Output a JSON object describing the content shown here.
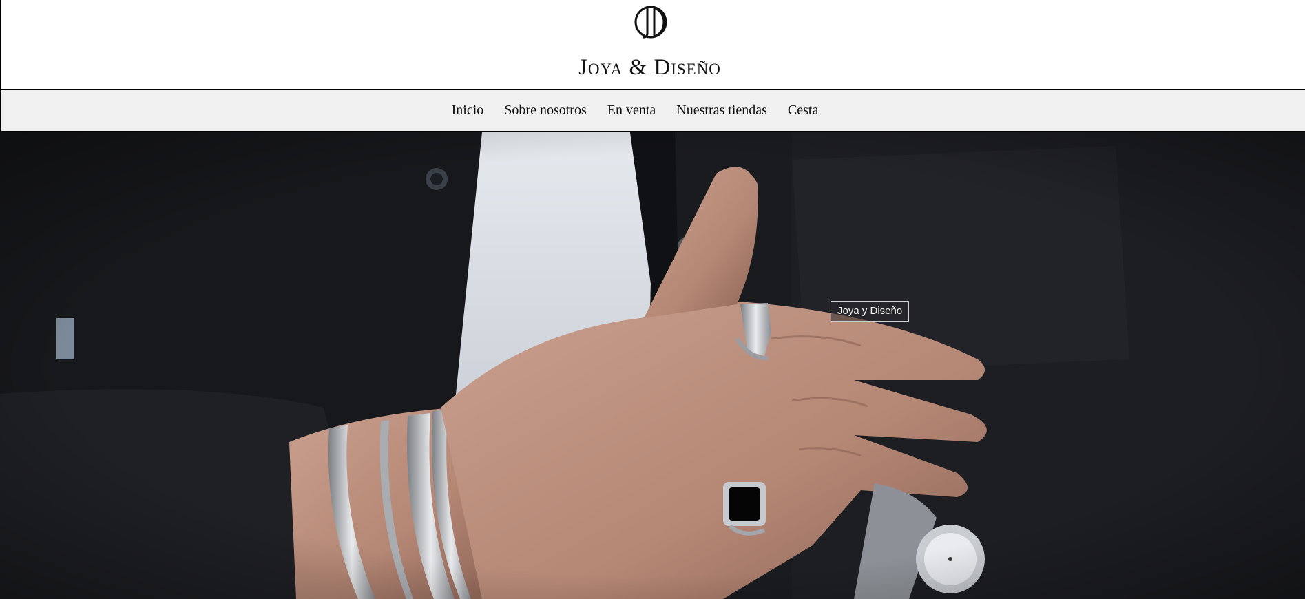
{
  "header": {
    "logo_icon": "jd-monogram-icon",
    "brand_name": "Joya & Diseño"
  },
  "nav": {
    "items": [
      {
        "label": "Inicio"
      },
      {
        "label": "Sobre nosotros"
      },
      {
        "label": "En venta"
      },
      {
        "label": "Nuestras tiendas"
      },
      {
        "label": "Cesta"
      }
    ]
  },
  "hero": {
    "badge_text": "Joya y Diseño",
    "image_subject": "hand-with-silver-rings-and-bracelets-photo"
  },
  "colors": {
    "header_bg": "#ffffff",
    "nav_bg": "#f0f0f0",
    "text": "#111111",
    "hero_bg": "#17181c"
  }
}
